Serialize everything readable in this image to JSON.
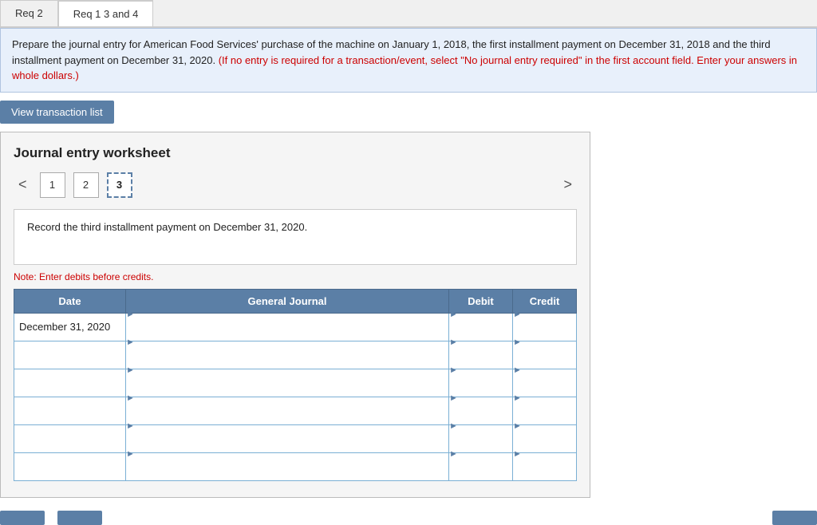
{
  "tabs": [
    {
      "id": "req2",
      "label": "Req 2",
      "active": false
    },
    {
      "id": "req13and4",
      "label": "Req 1 3 and 4",
      "active": true
    }
  ],
  "instructions": {
    "main_text": "Prepare the journal entry for American Food Services' purchase of the machine on January 1, 2018, the first installment payment on December 31, 2018 and the third installment payment on December 31, 2020.",
    "red_text": "(If no entry is required for a transaction/event, select \"No journal entry required\" in the first account field. Enter your answers in whole dollars.)"
  },
  "view_transaction_btn": "View transaction list",
  "worksheet": {
    "title": "Journal entry worksheet",
    "steps": [
      {
        "label": "1",
        "active": false
      },
      {
        "label": "2",
        "active": false
      },
      {
        "label": "3",
        "active": true
      }
    ],
    "nav_prev": "<",
    "nav_next": ">",
    "task_description": "Record the third installment payment on December 31, 2020.",
    "note": "Note: Enter debits before credits.",
    "table": {
      "headers": [
        "Date",
        "General Journal",
        "Debit",
        "Credit"
      ],
      "rows": [
        {
          "date": "December 31, 2020",
          "journal": "",
          "debit": "",
          "credit": ""
        },
        {
          "date": "",
          "journal": "",
          "debit": "",
          "credit": ""
        },
        {
          "date": "",
          "journal": "",
          "debit": "",
          "credit": ""
        },
        {
          "date": "",
          "journal": "",
          "debit": "",
          "credit": ""
        },
        {
          "date": "",
          "journal": "",
          "debit": "",
          "credit": ""
        },
        {
          "date": "",
          "journal": "",
          "debit": "",
          "credit": ""
        }
      ]
    }
  },
  "bottom_buttons": [
    {
      "id": "prev-btn",
      "label": ""
    },
    {
      "id": "next-btn",
      "label": ""
    },
    {
      "id": "save-btn",
      "label": ""
    }
  ],
  "colors": {
    "accent_blue": "#5b7fa6",
    "header_blue": "#5b7fa6",
    "red": "#cc0000",
    "instructions_bg": "#e8f0fb"
  }
}
